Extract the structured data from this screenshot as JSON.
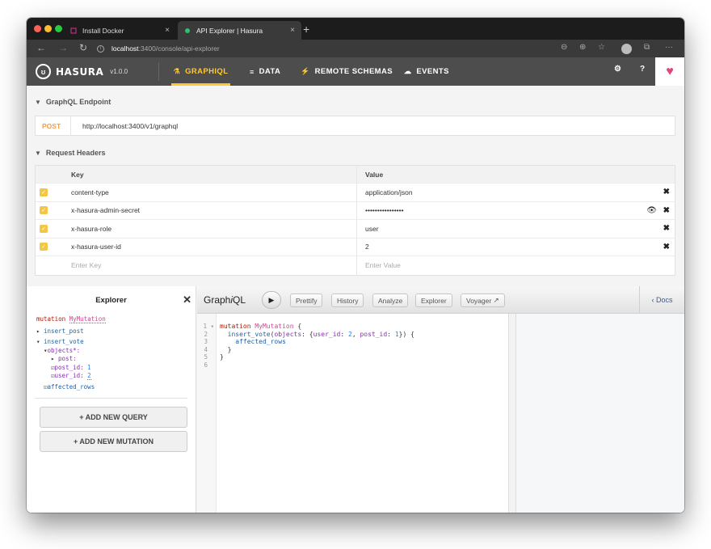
{
  "browser": {
    "tabs": [
      {
        "title": "Install Docker",
        "close": "×"
      },
      {
        "title": "API Explorer | Hasura",
        "close": "×"
      }
    ],
    "new_tab": "+",
    "address": {
      "host": "localhost",
      "path": ":3400/console/api-explorer"
    }
  },
  "nav": {
    "logo": "HASURA",
    "version": "v1.0.0",
    "items": [
      {
        "label": "GRAPHIQL",
        "icon": "flask-icon"
      },
      {
        "label": "DATA",
        "icon": "database-icon"
      },
      {
        "label": "REMOTE SCHEMAS",
        "icon": "plug-icon"
      },
      {
        "label": "EVENTS",
        "icon": "cloud-icon"
      }
    ],
    "help": "?"
  },
  "endpoint": {
    "section_title": "GraphQL Endpoint",
    "method": "POST",
    "url": "http://localhost:3400/v1/graphql"
  },
  "headers": {
    "section_title": "Request Headers",
    "col_key": "Key",
    "col_value": "Value",
    "rows": [
      {
        "key": "content-type",
        "value": "application/json"
      },
      {
        "key": "x-hasura-admin-secret",
        "value": "••••••••••••••••"
      },
      {
        "key": "x-hasura-role",
        "value": "user"
      },
      {
        "key": "x-hasura-user-id",
        "value": "2"
      }
    ],
    "key_placeholder": "Enter Key",
    "value_placeholder": "Enter Value"
  },
  "explorer": {
    "title": "Explorer",
    "mutation_kw": "mutation",
    "mutation_name": "MyMutation",
    "insert_post": "insert_post",
    "insert_vote": "insert_vote",
    "objects": "objects",
    "objects_star": "*:",
    "post": "post:",
    "post_id": "post_id:",
    "post_id_val": "1",
    "user_id": "user_id:",
    "user_id_val": "2",
    "affected_rows": "affected_rows",
    "add_query": "+ ADD NEW QUERY",
    "add_mutation": "+ ADD NEW MUTATION"
  },
  "graphiql": {
    "title_graph": "Graph",
    "title_i": "i",
    "title_ql": "QL",
    "buttons": [
      "Prettify",
      "History",
      "Analyze",
      "Explorer",
      "Voyager"
    ],
    "docs": "Docs",
    "line_numbers": [
      "1",
      "2",
      "3",
      "4",
      "5",
      "6"
    ]
  },
  "colors": {
    "accent": "#ffc837",
    "nav_bg": "#4d4d4d",
    "method": "#f59e4b",
    "checkbox": "#f3c643"
  }
}
